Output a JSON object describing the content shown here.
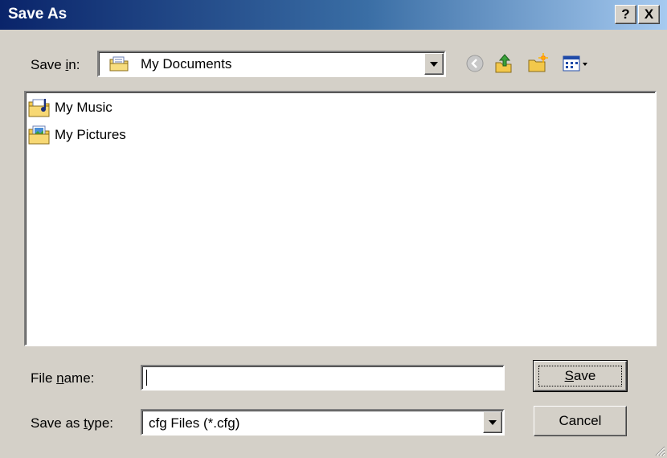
{
  "window": {
    "title": "Save As"
  },
  "caption_buttons": {
    "help": "?",
    "close": "X"
  },
  "save_in": {
    "label_pre": "Save ",
    "label_accel": "i",
    "label_post": "n:",
    "value": "My Documents",
    "icon": "my-documents-folder-icon"
  },
  "toolbar": {
    "icons": [
      "back-icon",
      "up-one-level-icon",
      "new-folder-icon",
      "views-menu-icon"
    ]
  },
  "files": [
    {
      "name": "My Music",
      "icon": "music-folder-icon"
    },
    {
      "name": "My Pictures",
      "icon": "pictures-folder-icon"
    }
  ],
  "file_name": {
    "label_pre": "File ",
    "label_accel": "n",
    "label_post": "ame:",
    "value": ""
  },
  "save_as_type": {
    "label_pre": "Save as ",
    "label_accel": "t",
    "label_post": "ype:",
    "value": "cfg Files (*.cfg)"
  },
  "buttons": {
    "save_accel": "S",
    "save_rest": "ave",
    "cancel": "Cancel"
  },
  "colors": {
    "title_start": "#0a246a",
    "title_end": "#a6caf0",
    "face": "#d4d0c8"
  }
}
